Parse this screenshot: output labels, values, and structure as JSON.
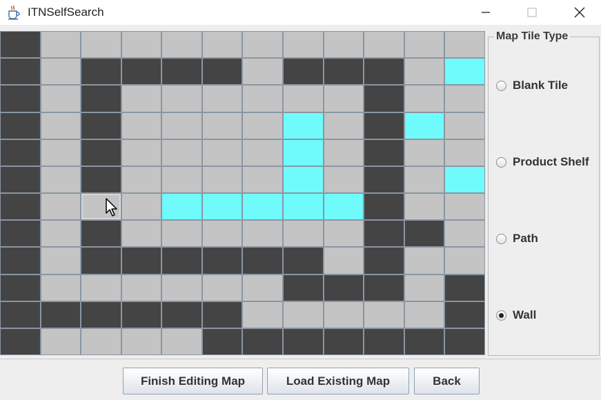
{
  "window": {
    "title": "ITNSelfSearch",
    "icon": "java-cup-icon",
    "controls": [
      "minimize-icon",
      "maximize-icon",
      "close-icon"
    ]
  },
  "map": {
    "rows": 12,
    "cols": 12,
    "legend": {
      "B": "Blank Tile",
      "W": "Wall",
      "P": "Path"
    },
    "colors": {
      "blank": "#c4c4c4",
      "wall": "#444444",
      "path": "#6ffbfb",
      "grid_line": "#8a96a3"
    },
    "tiles": [
      "WBBBBBBBBBBB",
      "WBWWWWBWWWBP",
      "WBWBBBBBBWBB",
      "WBWBBBBPBWPB",
      "WBWBBBBPBWBB",
      "WBWBBBBPBWBP",
      "WBBBPPPPPWBB",
      "WBWBBBBBBWWB",
      "WBWWWWWWBWBB",
      "WBBBBBBWWWBW",
      "WWWWWWBBBBBW",
      "WBBBBWWWWWWW"
    ],
    "hovered_cell": {
      "row": 6,
      "col": 2
    }
  },
  "tile_panel": {
    "title": "Map Tile Type",
    "options": [
      {
        "label": "Blank Tile",
        "checked": false
      },
      {
        "label": "Product Shelf",
        "checked": false
      },
      {
        "label": "Path",
        "checked": false
      },
      {
        "label": "Wall",
        "checked": true
      }
    ]
  },
  "buttons": {
    "finish": "Finish Editing Map",
    "load": "Load Existing Map",
    "back": "Back"
  }
}
